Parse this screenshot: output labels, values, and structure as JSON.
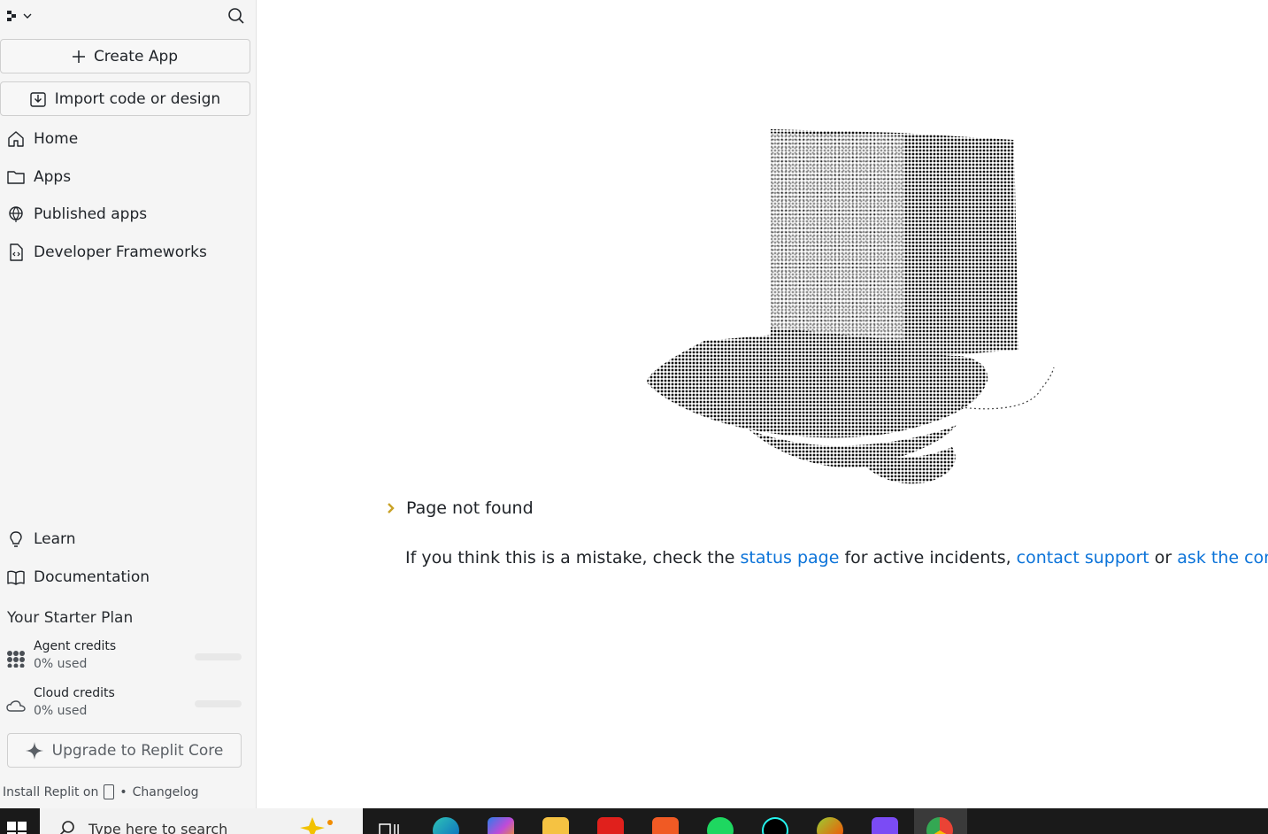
{
  "sidebar": {
    "create_label": "Create App",
    "import_label": "Import code or design",
    "nav": [
      {
        "label": "Home",
        "icon": "home-icon"
      },
      {
        "label": "Apps",
        "icon": "folder-icon"
      },
      {
        "label": "Published apps",
        "icon": "globe-icon"
      },
      {
        "label": "Developer Frameworks",
        "icon": "code-file-icon"
      }
    ],
    "learn": [
      {
        "label": "Learn",
        "icon": "lightbulb-icon"
      },
      {
        "label": "Documentation",
        "icon": "book-icon"
      }
    ],
    "plan": {
      "title": "Your Starter Plan",
      "credits": [
        {
          "name": "Agent credits",
          "used": "0% used",
          "fraction": 0
        },
        {
          "name": "Cloud credits",
          "used": "0% used",
          "fraction": 0
        }
      ],
      "upgrade_label": "Upgrade to Replit Core"
    },
    "footer": {
      "install": "Install Replit on",
      "separator": "•",
      "changelog": "Changelog"
    }
  },
  "main": {
    "not_found": "Page not found",
    "message_prefix": "If you think this is a mistake, check the ",
    "status_link": "status page",
    "message_middle": " for active incidents, ",
    "support_link": "contact support",
    "message_or": " or ",
    "community_link": "ask the communit"
  },
  "taskbar": {
    "search_placeholder": "Type here to search"
  },
  "colors": {
    "link": "#0b73d9",
    "accent": "#c9a227",
    "sidebar_bg": "#f5f5f5"
  }
}
